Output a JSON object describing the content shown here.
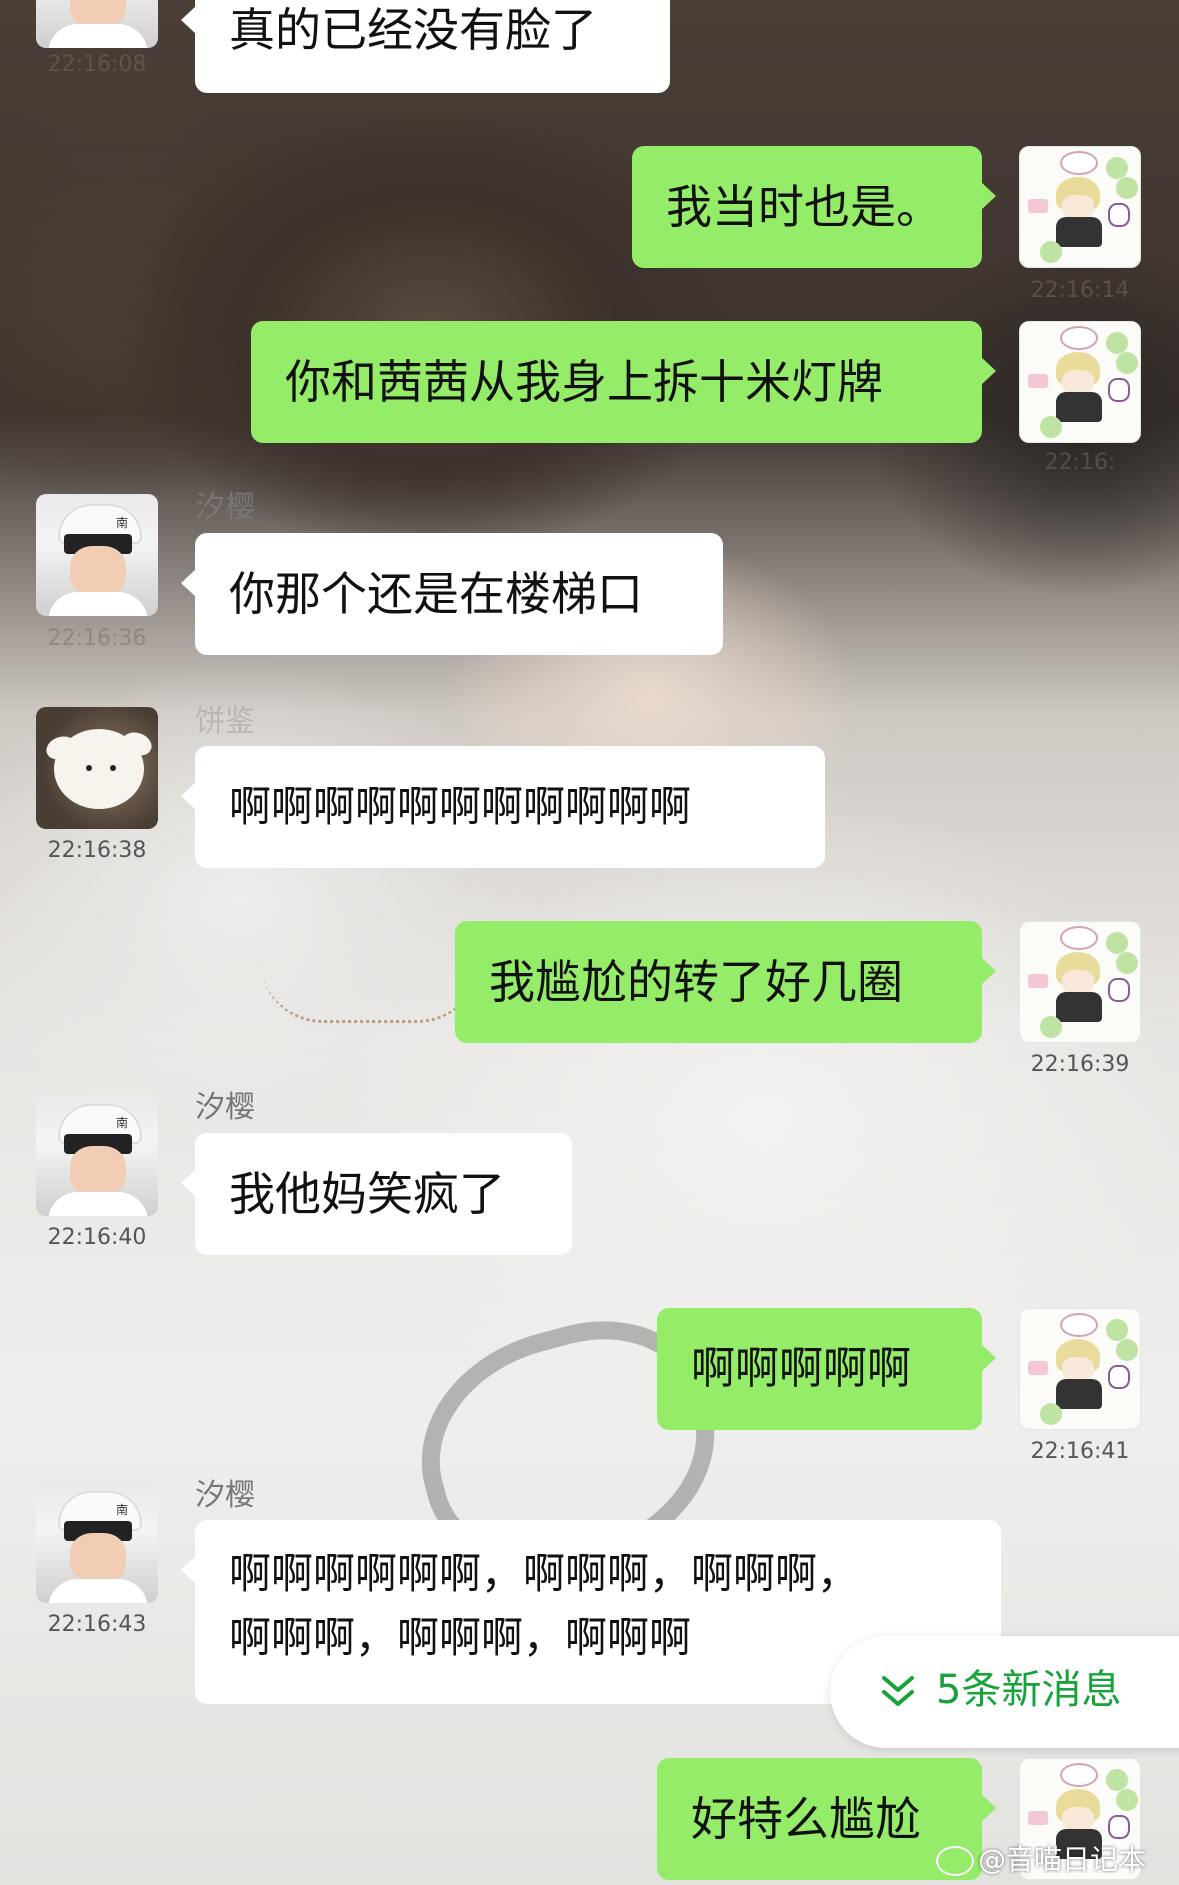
{
  "messages": [
    {
      "side": "in",
      "text": "真的已经没有脸了",
      "time": "22:16:08",
      "avatar": "boy-cap"
    },
    {
      "side": "out",
      "text": "我当时也是。",
      "time": "22:16:14",
      "avatar": "anime-clover"
    },
    {
      "side": "out",
      "text": "你和茜茜从我身上拆十米灯牌",
      "time": "22:16:",
      "avatar": "anime-clover"
    },
    {
      "side": "in",
      "sender": "汐樱",
      "text": "你那个还是在楼梯口",
      "time": "22:16:36",
      "avatar": "boy-cap"
    },
    {
      "side": "in",
      "sender": "饼鉴",
      "text": "啊啊啊啊啊啊啊啊啊啊啊",
      "time": "22:16:38",
      "avatar": "sheep-plush"
    },
    {
      "side": "out",
      "text": "我尴尬的转了好几圈",
      "time": "22:16:39",
      "avatar": "anime-clover"
    },
    {
      "side": "in",
      "sender": "汐樱",
      "text": "我他妈笑疯了",
      "time": "22:16:40",
      "avatar": "boy-cap"
    },
    {
      "side": "out",
      "text": "啊啊啊啊啊",
      "time": "22:16:41",
      "avatar": "anime-clover"
    },
    {
      "side": "in",
      "sender": "汐樱",
      "text_line1": "啊啊啊啊啊啊，啊啊啊，啊啊啊，",
      "text_line2": "啊啊啊，啊啊啊，啊啊啊",
      "time": "22:16:43",
      "avatar": "boy-cap"
    },
    {
      "side": "out",
      "text": "好特么尴尬",
      "avatar": "anime-clover"
    }
  ],
  "new_messages_button": {
    "label": "5条新消息",
    "icon": "double-chevron-down-icon",
    "color": "#17a33a"
  },
  "watermark": {
    "text": "@音喵日记本",
    "icon": "weibo-icon"
  },
  "colors": {
    "outgoing_bubble": "#95ec69",
    "incoming_bubble": "#ffffff",
    "accent": "#17a33a"
  }
}
